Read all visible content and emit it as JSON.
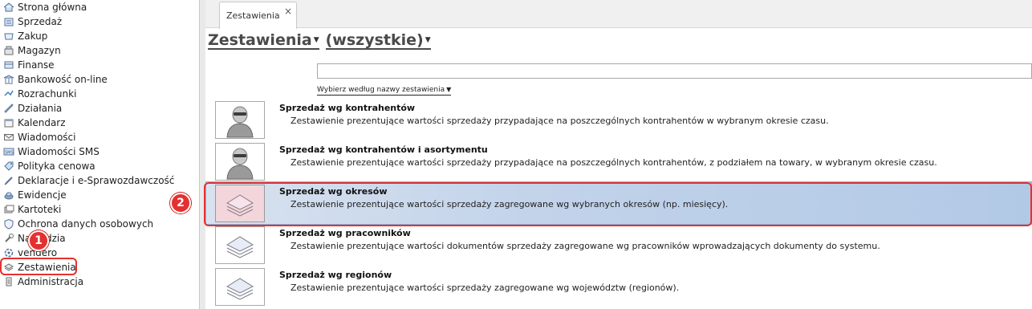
{
  "sidebar": {
    "items": [
      {
        "label": "Strona główna",
        "icon": "home-icon"
      },
      {
        "label": "Sprzedaż",
        "icon": "sales-icon"
      },
      {
        "label": "Zakup",
        "icon": "purchase-icon"
      },
      {
        "label": "Magazyn",
        "icon": "warehouse-icon"
      },
      {
        "label": "Finanse",
        "icon": "finance-icon"
      },
      {
        "label": "Bankowość on-line",
        "icon": "bank-icon"
      },
      {
        "label": "Rozrachunki",
        "icon": "settlements-icon"
      },
      {
        "label": "Działania",
        "icon": "actions-icon"
      },
      {
        "label": "Kalendarz",
        "icon": "calendar-icon"
      },
      {
        "label": "Wiadomości",
        "icon": "mail-icon"
      },
      {
        "label": "Wiadomości SMS",
        "icon": "sms-icon"
      },
      {
        "label": "Polityka cenowa",
        "icon": "price-tag-icon"
      },
      {
        "label": "Deklaracje i e-Sprawozdawczość",
        "icon": "declarations-icon"
      },
      {
        "label": "Ewidencje",
        "icon": "records-icon"
      },
      {
        "label": "Kartoteki",
        "icon": "cards-icon"
      },
      {
        "label": "Ochrona danych osobowych",
        "icon": "shield-icon"
      },
      {
        "label": "Narzędzia",
        "icon": "tools-icon"
      },
      {
        "label": "vendero",
        "icon": "vendero-icon"
      },
      {
        "label": "Zestawienia",
        "icon": "reports-icon"
      },
      {
        "label": "Administracja",
        "icon": "admin-icon"
      }
    ]
  },
  "tabs": {
    "active_label": "Zestawienia",
    "close_glyph": "×"
  },
  "main": {
    "title_primary": "Zestawienia",
    "title_secondary": "(wszystkie)",
    "search_value": "",
    "filter_link": "Wybierz według nazwy zestawienia",
    "reports": [
      {
        "title": "Sprzedaż wg kontrahentów",
        "description": "Zestawienie prezentujące wartości sprzedaży przypadające na poszczególnych kontrahentów w wybranym okresie czasu.",
        "icon": "person-icon"
      },
      {
        "title": "Sprzedaż wg kontrahentów i asortymentu",
        "description": "Zestawienie prezentujące wartości sprzedaży przypadające na poszczególnych kontrahentów, z podziałem na towary, w wybranym okresie czasu.",
        "icon": "person-icon"
      },
      {
        "title": "Sprzedaż wg okresów",
        "description": "Zestawienie prezentujące wartości sprzedaży zagregowane wg wybranych okresów (np. miesięcy).",
        "icon": "stack-icon",
        "selected": true
      },
      {
        "title": "Sprzedaż wg pracowników",
        "description": "Zestawienie prezentujące wartości dokumentów sprzedaży zagregowane wg pracowników wprowadzających dokumenty do systemu.",
        "icon": "stack-icon"
      },
      {
        "title": "Sprzedaż wg regionów",
        "description": "Zestawienie prezentujące wartości sprzedaży zagregowane wg województw (regionów).",
        "icon": "stack-icon"
      }
    ]
  },
  "annotations": {
    "badge_1": "1",
    "badge_2": "2"
  },
  "colors": {
    "selection": "#b9cde8",
    "annotation": "#e53030"
  }
}
